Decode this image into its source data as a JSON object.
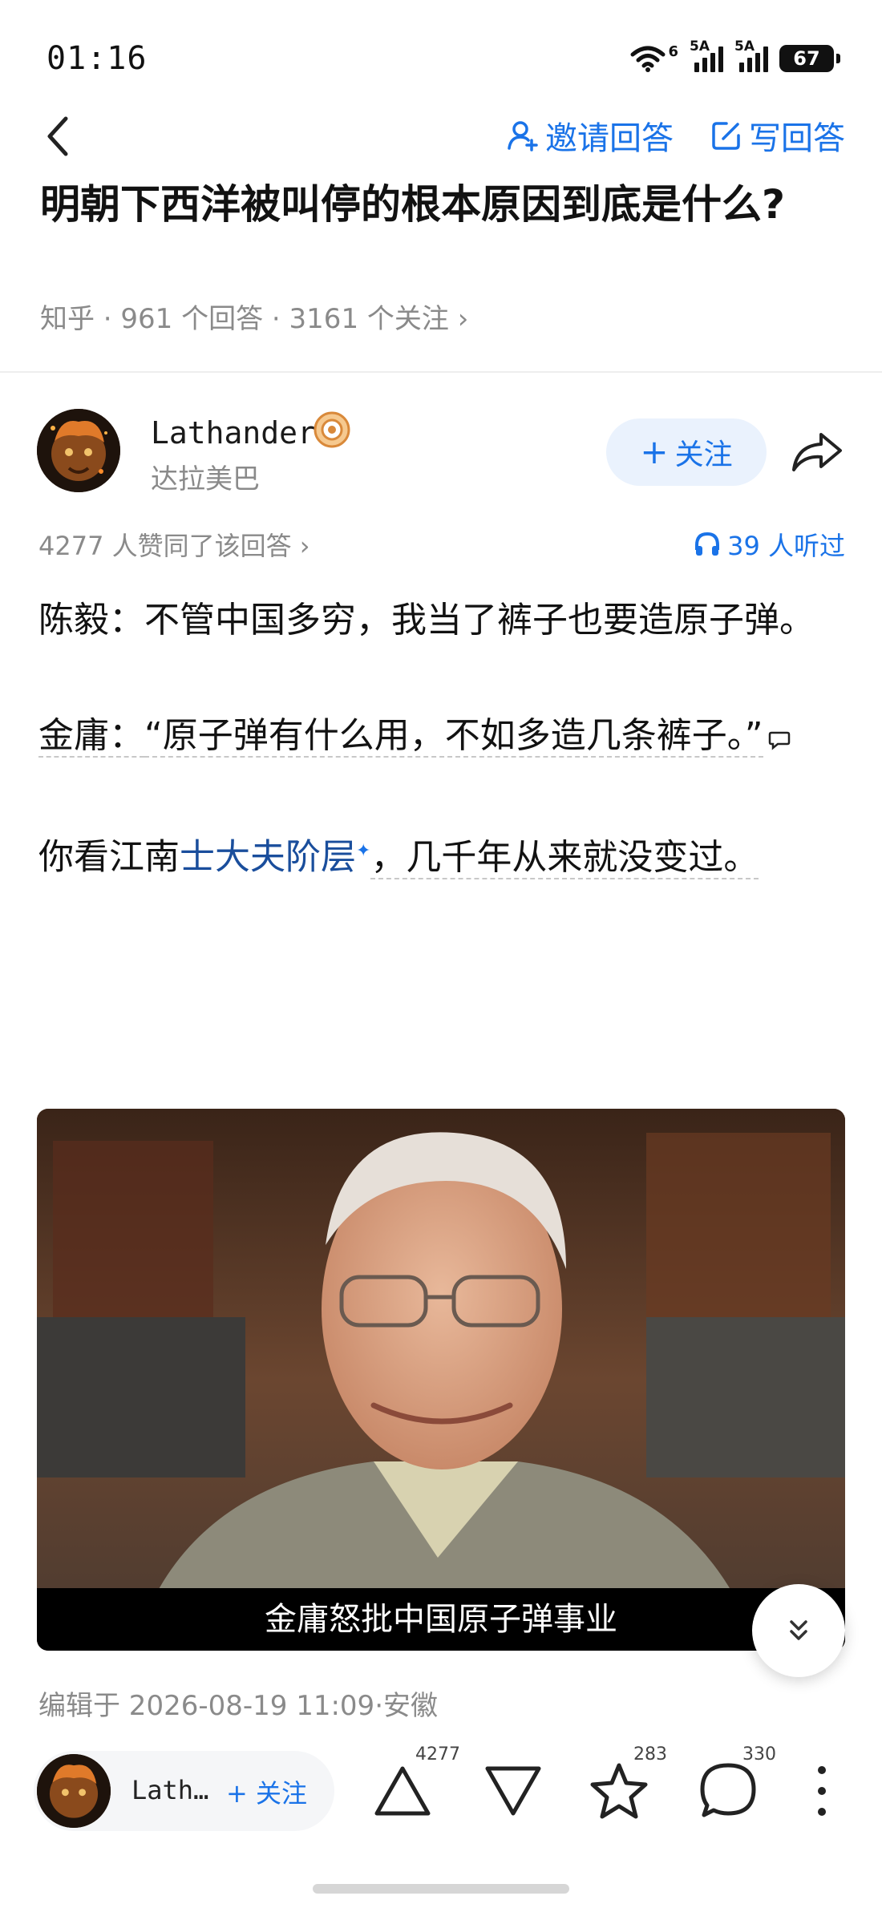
{
  "status": {
    "time": "01:16",
    "net1": "6",
    "sim1": "5A",
    "sim2": "5A",
    "battery": "67"
  },
  "nav": {
    "invite_label": "邀请回答",
    "write_label": "写回答"
  },
  "question": {
    "title": "明朝下西洋被叫停的根本原因到底是什么?",
    "meta": "知乎 · 961 个回答 · 3161 个关注 ›"
  },
  "author": {
    "name": "Lathander",
    "subtitle": "达拉美巴",
    "follow_label": "关注",
    "chip_name": "Lath…"
  },
  "stats": {
    "agree_line": "4277 人赞同了该回答 ›",
    "listened": "39 人听过"
  },
  "content": {
    "p1": "陈毅：不管中国多穷，我当了裤子也要造原子弹。",
    "p2_prefix": "金庸：",
    "p2_quote": "“原子弹有什么用，不如多造几条裤子。”",
    "p3_prefix": "你看江南",
    "p3_link": "士大夫阶层",
    "p3_suffix": "，几千年从来就没变过。",
    "image_caption": "金庸怒批中国原子弹事业"
  },
  "edit_info": "编辑于 2026-08-19 11:09·安徽",
  "bottom": {
    "upvote_count": "4277",
    "favorite_count": "283",
    "comment_count": "330"
  },
  "icons": [
    "back-icon",
    "user-plus-icon",
    "edit-icon",
    "badge-icon",
    "share-icon",
    "headphones-icon",
    "comment-mark-icon",
    "chevrons-down-icon",
    "upvote-icon",
    "downvote-icon",
    "star-icon",
    "comment-icon",
    "more-icon"
  ],
  "colors": {
    "accent": "#1a73e8",
    "link": "#1a4e9c",
    "muted": "#8a8a8a"
  }
}
